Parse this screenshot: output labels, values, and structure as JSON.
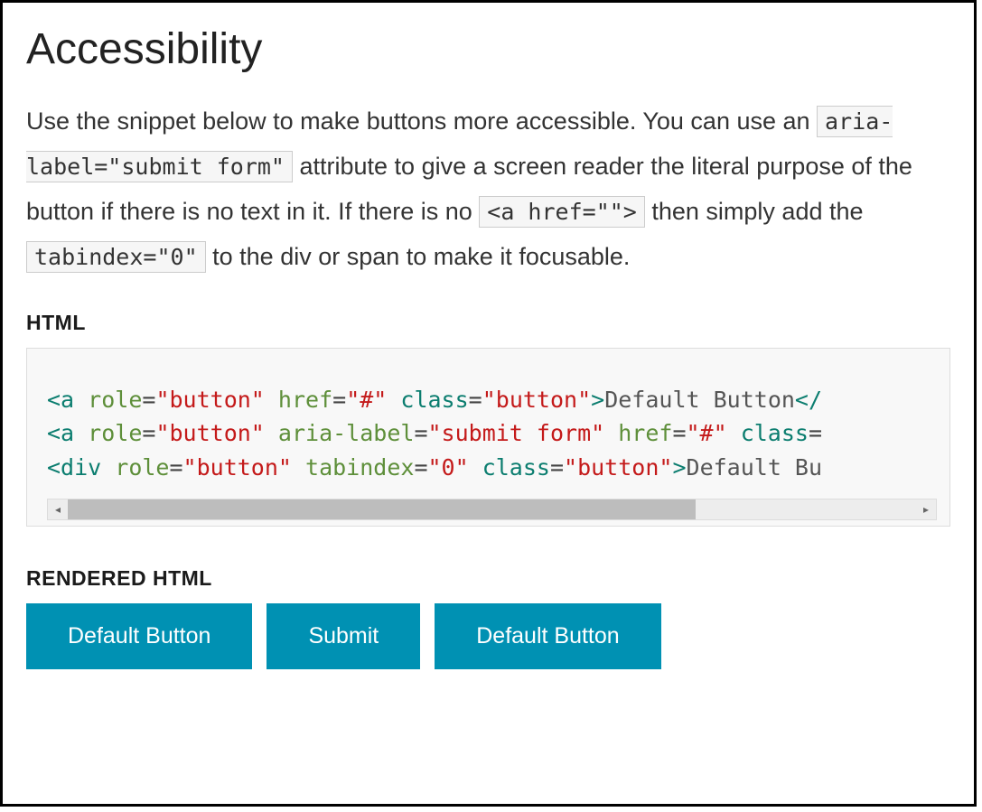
{
  "title": "Accessibility",
  "paragraph": {
    "p1": "Use the snippet below to make buttons more accessible. You can use an ",
    "c1": "aria-label=\"submit form\"",
    "p2": " attribute to give a screen reader the literal purpose of the button if there is no text in it. If there is no ",
    "c2": "<a href=\"\">",
    "p3": " then simply add the ",
    "c3": "tabindex=\"0\"",
    "p4": " to the div or span to make it focusable."
  },
  "labels": {
    "html": "HTML",
    "rendered": "RENDERED HTML"
  },
  "code": {
    "l1": {
      "tag_open": "<a",
      "attr1": " role",
      "val1": "\"button\"",
      "attr2": " href",
      "val2": "\"#\"",
      "attr3": " class",
      "val3": "\"button\"",
      "close": ">",
      "text": "Default Button",
      "tag_close": "</"
    },
    "l2": {
      "tag_open": "<a",
      "attr1": " role",
      "val1": "\"button\"",
      "attr2": " aria-label",
      "val2": "\"submit form\"",
      "attr3": " href",
      "val3": "\"#\"",
      "attr4": " class",
      "eq": "="
    },
    "l3": {
      "tag_open": "<div",
      "attr1": " role",
      "val1": "\"button\"",
      "attr2": " tabindex",
      "val2": "\"0\"",
      "attr3": " class",
      "val3": "\"button\"",
      "close": ">",
      "text": "Default Bu"
    }
  },
  "buttons": {
    "b1": "Default Button",
    "b2": "Submit",
    "b3": "Default Button"
  }
}
